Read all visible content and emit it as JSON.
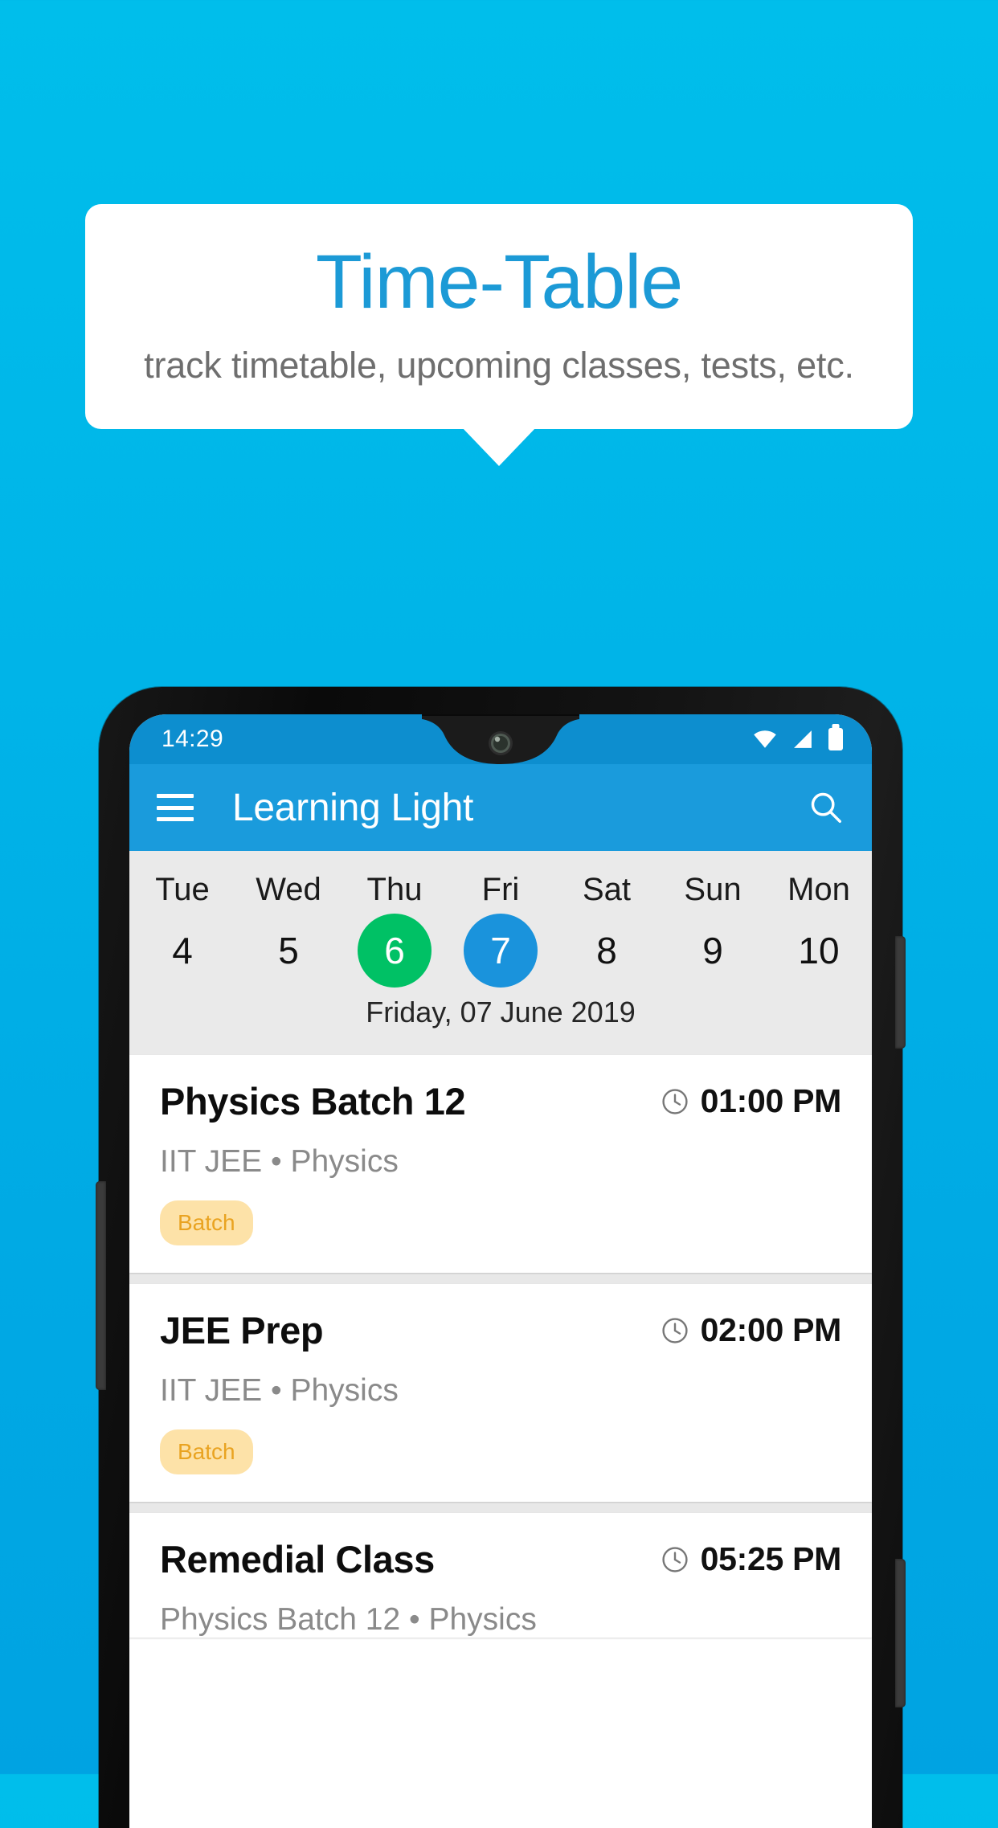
{
  "promo": {
    "title": "Time-Table",
    "subtitle": "track timetable, upcoming classes, tests, etc.",
    "title_color": "#1C9AD6",
    "background_color": "#00B4E8"
  },
  "phone": {
    "status_bar": {
      "time": "14:29",
      "icons": [
        "wifi-icon",
        "signal-icon",
        "battery-icon"
      ],
      "background_color": "#0D8ECF"
    },
    "app_bar": {
      "menu_icon": "hamburger-menu-icon",
      "title": "Learning Light",
      "action_icon": "search-icon",
      "background_color": "#1A9BDC"
    },
    "date_strip": {
      "days": [
        {
          "name": "Tue",
          "num": "4",
          "state": "normal"
        },
        {
          "name": "Wed",
          "num": "5",
          "state": "normal"
        },
        {
          "name": "Thu",
          "num": "6",
          "state": "today"
        },
        {
          "name": "Fri",
          "num": "7",
          "state": "selected"
        },
        {
          "name": "Sat",
          "num": "8",
          "state": "normal"
        },
        {
          "name": "Sun",
          "num": "9",
          "state": "normal"
        },
        {
          "name": "Mon",
          "num": "10",
          "state": "normal"
        }
      ],
      "full_date": "Friday, 07 June 2019",
      "today_color": "#00C165",
      "selected_color": "#1A93DC"
    },
    "classes": [
      {
        "title": "Physics Batch 12",
        "time": "01:00 PM",
        "subtitle": "IIT JEE • Physics",
        "tag": "Batch",
        "clock_icon": "clock-icon"
      },
      {
        "title": "JEE Prep",
        "time": "02:00 PM",
        "subtitle": "IIT JEE • Physics",
        "tag": "Batch",
        "clock_icon": "clock-icon"
      },
      {
        "title": "Remedial Class",
        "time": "05:25 PM",
        "subtitle": "Physics Batch 12 • Physics",
        "tag": "",
        "clock_icon": "clock-icon"
      }
    ]
  }
}
